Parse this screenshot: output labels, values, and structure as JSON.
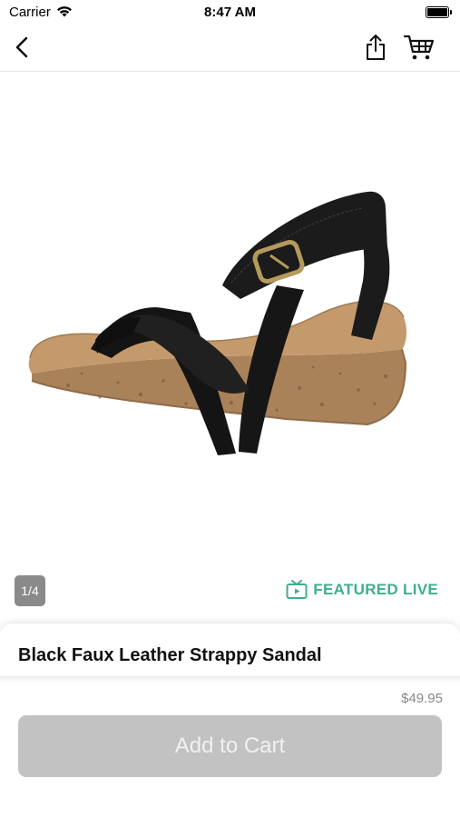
{
  "status_bar": {
    "carrier": "Carrier",
    "time": "8:47 AM"
  },
  "nav": {
    "back_icon": "chevron-left-icon",
    "share_icon": "share-icon",
    "cart_icon": "cart-icon"
  },
  "gallery": {
    "counter": "1/4"
  },
  "featured": {
    "label": "FEATURED LIVE",
    "icon": "tv-icon",
    "color": "#3fae8f"
  },
  "product": {
    "title": "Black Faux Leather Strappy Sandal",
    "price": "$49.95",
    "add_to_cart_label": "Add to Cart"
  },
  "colors": {
    "button_disabled": "#c2c2c2",
    "price_text": "#888888"
  }
}
